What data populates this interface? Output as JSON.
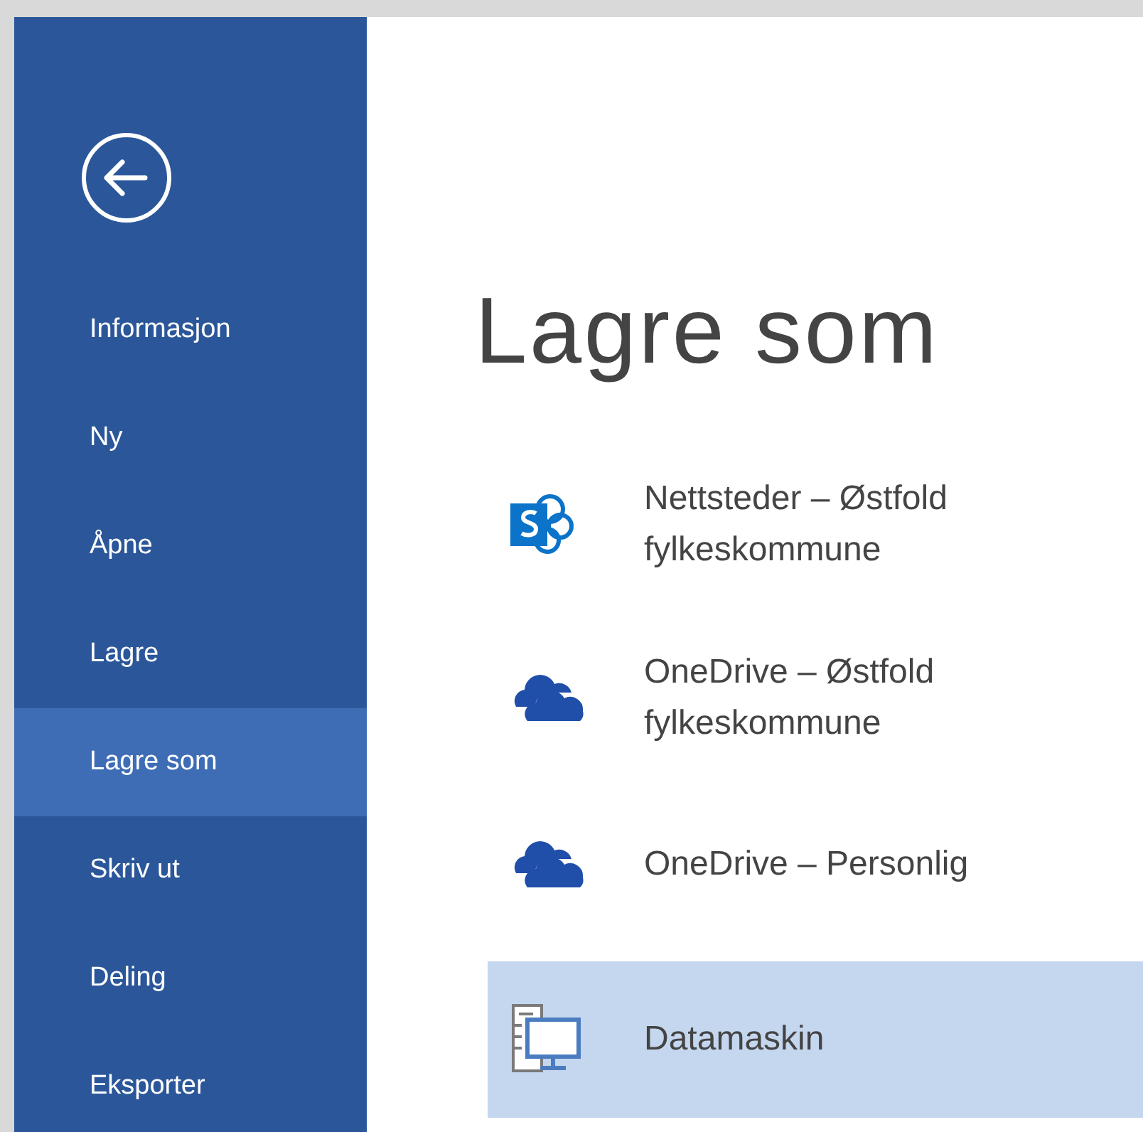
{
  "sidebar": {
    "items": [
      {
        "label": "Informasjon",
        "selected": false
      },
      {
        "label": "Ny",
        "selected": false
      },
      {
        "label": "Åpne",
        "selected": false
      },
      {
        "label": "Lagre",
        "selected": false
      },
      {
        "label": "Lagre som",
        "selected": true
      },
      {
        "label": "Skriv ut",
        "selected": false
      },
      {
        "label": "Deling",
        "selected": false
      },
      {
        "label": "Eksporter",
        "selected": false
      }
    ]
  },
  "main": {
    "title": "Lagre som",
    "locations": [
      {
        "kind": "sharepoint",
        "lines": [
          "Nettsteder – Østfold",
          "fylkeskommune"
        ],
        "selected": false
      },
      {
        "kind": "cloud",
        "lines": [
          "OneDrive – Østfold",
          "fylkeskommune"
        ],
        "selected": false
      },
      {
        "kind": "cloud",
        "lines": [
          "OneDrive – Personlig"
        ],
        "selected": false
      },
      {
        "kind": "computer",
        "lines": [
          "Datamaskin"
        ],
        "selected": true
      }
    ]
  }
}
